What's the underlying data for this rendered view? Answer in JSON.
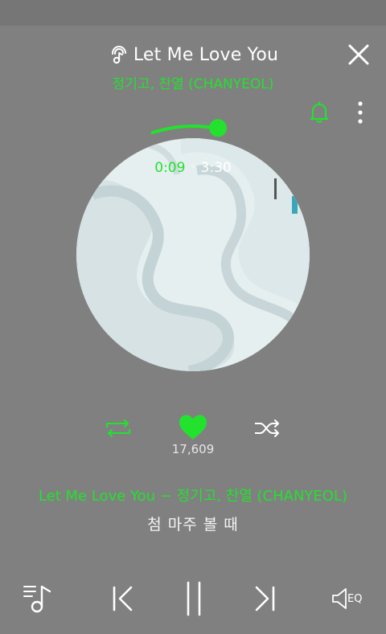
{
  "header": {
    "title": "Let Me Love You",
    "artist": "정기고, 찬열 (CHANYEOL)",
    "title_icon": "mic-hand-icon",
    "close_icon": "close-icon",
    "alarm_icon": "bell-icon",
    "more_icon": "more-vertical-icon"
  },
  "player": {
    "current_time": "0:09",
    "separator": "•",
    "duration": "3:30",
    "progress": 0.043,
    "like_count": "17,609",
    "liked": true
  },
  "lyrics": {
    "title_line": "Let Me Love You − 정기고, 찬열 (CHANYEOL)",
    "current_line": "첨 마주 볼 때"
  },
  "colors": {
    "accent": "#22e22e",
    "background": "#808080",
    "text": "#ffffff"
  },
  "controls": {
    "playlist_icon": "playlist-music-icon",
    "prev_icon": "previous-icon",
    "pause_icon": "pause-icon",
    "next_icon": "next-icon",
    "eq_label": "EQ",
    "repeat_icon": "repeat-icon",
    "heart_icon": "heart-icon",
    "shuffle_icon": "shuffle-icon"
  }
}
